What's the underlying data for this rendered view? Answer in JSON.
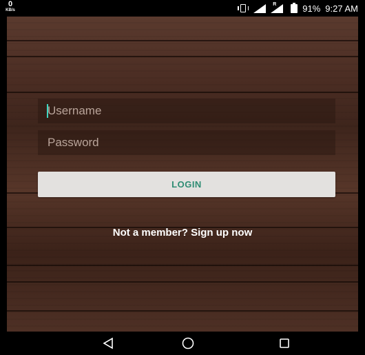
{
  "status_bar": {
    "data_speed_value": "0",
    "data_speed_unit": "KB/s",
    "roaming_label": "R",
    "battery_percent": "91%",
    "time": "9:27 AM"
  },
  "login_form": {
    "username_placeholder": "Username",
    "password_placeholder": "Password",
    "login_label": "LOGIN",
    "signup_text": "Not a member? Sign up now"
  },
  "icons": {
    "vibrate": "vibrate-icon",
    "signal": "signal-icon",
    "battery": "battery-icon",
    "back": "back-icon",
    "home": "home-icon",
    "recents": "recents-icon"
  },
  "colors": {
    "accent": "#2e8c73",
    "cursor": "#3fd7c1",
    "button_bg": "#e3e1df"
  }
}
